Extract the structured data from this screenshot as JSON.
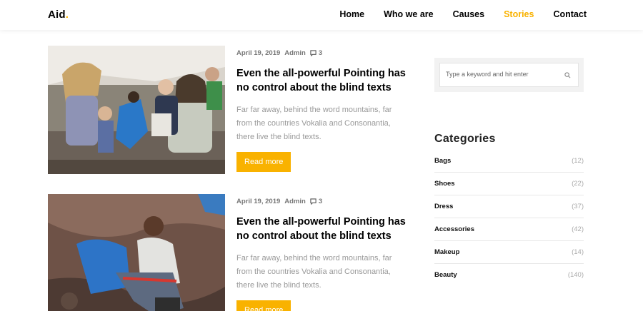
{
  "header": {
    "logo_text": "Aid",
    "logo_dot": ".",
    "nav": [
      {
        "label": "Home"
      },
      {
        "label": "Who we are"
      },
      {
        "label": "Causes"
      },
      {
        "label": "Stories",
        "active": true
      },
      {
        "label": "Contact"
      }
    ]
  },
  "posts": [
    {
      "date": "April 19, 2019",
      "author": "Admin",
      "comments": "3",
      "title": "Even the all-powerful Pointing has no control about the blind texts",
      "excerpt": "Far far away, behind the word mountains, far from the countries Vokalia and Consonantia, there live the blind texts.",
      "button": "Read more"
    },
    {
      "date": "April 19, 2019",
      "author": "Admin",
      "comments": "3",
      "title": "Even the all-powerful Pointing has no control about the blind texts",
      "excerpt": "Far far away, behind the word mountains, far from the countries Vokalia and Consonantia, there live the blind texts.",
      "button": "Read more"
    }
  ],
  "sidebar": {
    "search": {
      "placeholder": "Type a keyword and hit enter",
      "icon": "search-icon"
    },
    "categories_heading": "Categories",
    "categories": [
      {
        "label": "Bags",
        "count": "(12)"
      },
      {
        "label": "Shoes",
        "count": "(22)"
      },
      {
        "label": "Dress",
        "count": "(37)"
      },
      {
        "label": "Accessories",
        "count": "(42)"
      },
      {
        "label": "Makeup",
        "count": "(14)"
      },
      {
        "label": "Beauty",
        "count": "(140)"
      }
    ]
  },
  "colors": {
    "accent": "#f9b200",
    "muted_text": "#999999"
  }
}
